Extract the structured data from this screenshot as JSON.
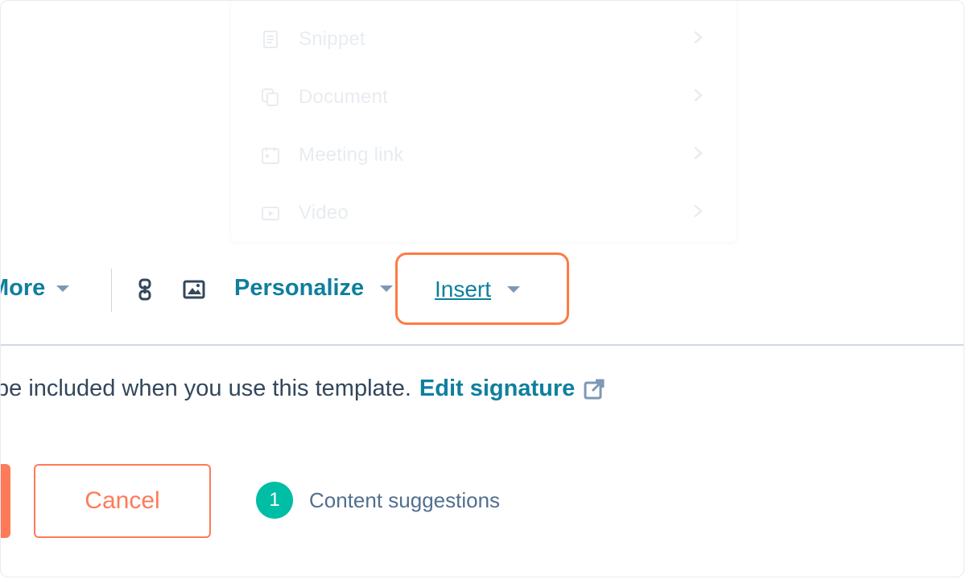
{
  "insert_menu": {
    "items": [
      {
        "label": "Snippet",
        "icon": "snippet-icon"
      },
      {
        "label": "Document",
        "icon": "document-icon"
      },
      {
        "label": "Meeting link",
        "icon": "calendar-icon"
      },
      {
        "label": "Video",
        "icon": "video-icon"
      }
    ]
  },
  "toolbar": {
    "more_label": "More",
    "link_icon": "link-icon",
    "image_icon": "image-icon",
    "personalize_label": "Personalize",
    "insert_label": "Insert"
  },
  "signature": {
    "text": "be included when you use this template.",
    "edit_link": "Edit signature",
    "edit_icon": "external-link-icon"
  },
  "footer": {
    "cancel_label": "Cancel",
    "suggestions_count": "1",
    "suggestions_label": "Content suggestions"
  },
  "colors": {
    "accent": "#0f7f9e",
    "primary_button": "#ff7a59",
    "highlight": "#ff7a45",
    "badge": "#00bda5"
  }
}
